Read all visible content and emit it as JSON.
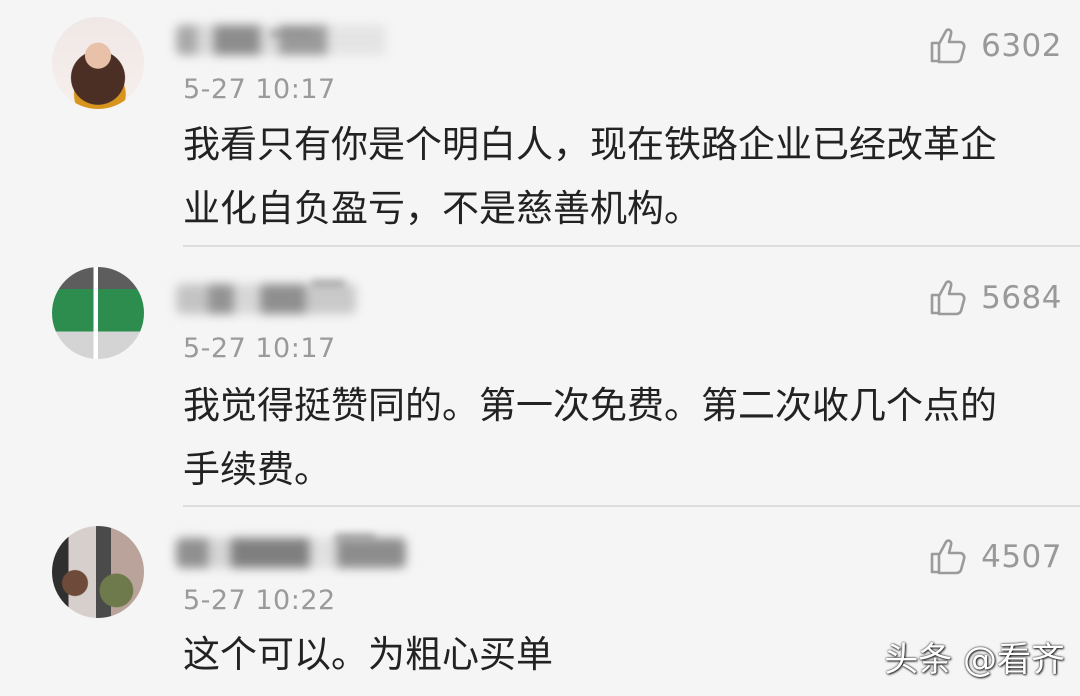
{
  "comments": [
    {
      "timestamp": "5-27 10:17",
      "likes": "6302",
      "text": "我看只有你是个明白人，现在铁路企业已经改革企\n业化自负盈亏，不是慈善机构。",
      "avatar_icon": "user-avatar"
    },
    {
      "timestamp": "5-27 10:17",
      "likes": "5684",
      "text": "我觉得挺赞同的。第一次免费。第二次收几个点的\n手续费。",
      "avatar_icon": "user-avatar"
    },
    {
      "timestamp": "5-27 10:22",
      "likes": "4507",
      "text": "这个可以。为粗心买单",
      "avatar_icon": "user-avatar"
    }
  ],
  "icons": {
    "like": "thumbs-up-icon"
  },
  "watermark": "头条 @看齐",
  "colors": {
    "background": "#f5f5f5",
    "text": "#222222",
    "meta": "#9a9a9a",
    "divider": "#dddddd",
    "watermark": "#ffffff"
  }
}
